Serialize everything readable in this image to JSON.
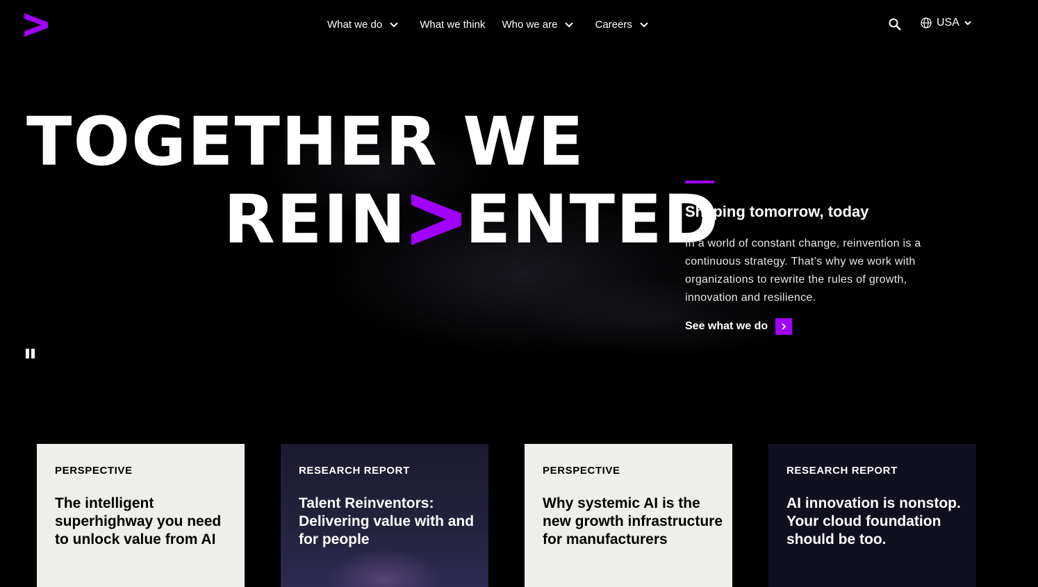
{
  "header": {
    "nav": [
      {
        "label": "What we do",
        "has_menu": true
      },
      {
        "label": "What we think",
        "has_menu": false
      },
      {
        "label": "Who we are",
        "has_menu": true
      },
      {
        "label": "Careers",
        "has_menu": true
      }
    ],
    "locale": "USA"
  },
  "hero": {
    "headline_line1": "TOGETHER WE",
    "headline_line2_part1": "REIN",
    "headline_line2_part2": "ENTED",
    "title": "Shaping tomorrow, today",
    "body": "In a world of constant change, reinvention is a continuous strategy. That’s why we work with organizations to rewrite the rules of growth, innovation and resilience.",
    "cta": "See what we do"
  },
  "cards": [
    {
      "tag": "PERSPECTIVE",
      "title": "The intelligent superhighway you need to unlock value from AI"
    },
    {
      "tag": "RESEARCH REPORT",
      "title": "Talent Reinventors: Delivering value with and for people"
    },
    {
      "tag": "PERSPECTIVE",
      "title": "Why systemic AI is the new growth infrastructure for manufacturers"
    },
    {
      "tag": "RESEARCH REPORT",
      "title": "AI innovation is nonstop. Your cloud foundation should be too."
    }
  ],
  "colors": {
    "accent": "#a100ff",
    "background": "#000000",
    "card_light": "#eeeeea"
  }
}
